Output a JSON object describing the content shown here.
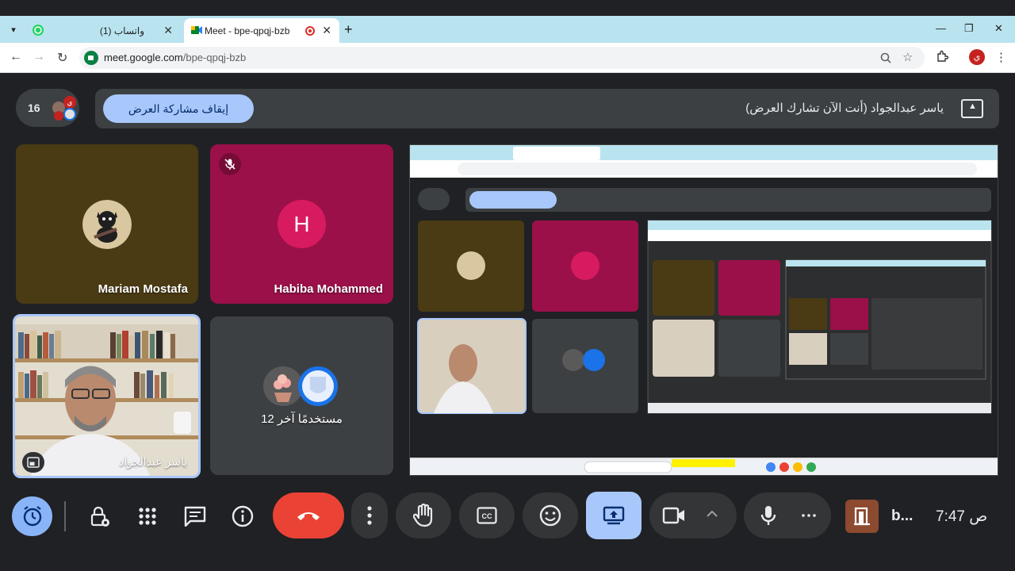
{
  "browser": {
    "tabs": [
      {
        "title": "(1) واتساب",
        "close": "✕"
      },
      {
        "title": "Meet - bpe-qpqj-bzb",
        "close": "✕"
      }
    ],
    "new_tab": "+",
    "window_controls": {
      "minimize": "—",
      "restore": "❐",
      "close": "✕"
    },
    "url_host": "meet.google.com",
    "url_path": "/bpe-qpqj-bzb",
    "profile_initial": "ي"
  },
  "meet": {
    "participant_count": "16",
    "stop_sharing_label": "إيقاف مشاركة العرض",
    "presenting_text": "ياسر عبدالجواد (أنت الآن تشارك العرض)",
    "tiles": [
      {
        "name": "Mariam Mostafa"
      },
      {
        "name": "Habiba Mohammed",
        "initial": "H"
      },
      {
        "name": "ياسر عبدالجواد"
      },
      {
        "name": "12 مستخدمًا آخر"
      }
    ],
    "clock": "7:47 ص",
    "meeting_code": "b..."
  },
  "colors": {
    "meet_bg": "#202124",
    "tile_dark": "#3c4043",
    "habiba_tile": "#9b1049",
    "habiba_avatar": "#d81b60",
    "mariam_tile": "#4a3b14",
    "hangup": "#ea4335",
    "accent_blue": "#a8c7fa",
    "tab_bar": "#b9e4ef"
  },
  "icons": [
    "whatsapp-icon",
    "meet-icon",
    "recording-icon",
    "back-icon",
    "forward-icon",
    "reload-icon",
    "zoom-icon",
    "star-icon",
    "extensions-icon",
    "menu-icon",
    "mic-off-icon",
    "picture-in-picture-icon",
    "timer-icon",
    "lock-icon",
    "apps-icon",
    "chat-icon",
    "info-icon",
    "hang-up-icon",
    "more-icon",
    "raise-hand-icon",
    "captions-icon",
    "emoji-icon",
    "present-icon",
    "camera-icon",
    "chevron-up-icon",
    "mic-icon",
    "door-icon"
  ]
}
